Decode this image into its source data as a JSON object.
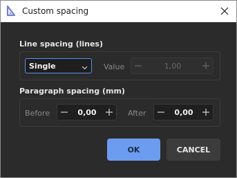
{
  "window": {
    "title": "Custom spacing"
  },
  "line_spacing": {
    "title": "Line spacing (lines)",
    "selected": "Single",
    "value_label": "Value",
    "value": "1,00"
  },
  "paragraph_spacing": {
    "title": "Paragraph spacing (mm)",
    "before_label": "Before",
    "before_value": "0,00",
    "after_label": "After",
    "after_value": "0,00"
  },
  "buttons": {
    "ok": "OK",
    "cancel": "CANCEL"
  },
  "colors": {
    "accent": "#6c9cf0",
    "background": "#2b2b2b",
    "titlebar": "#ffffff"
  }
}
